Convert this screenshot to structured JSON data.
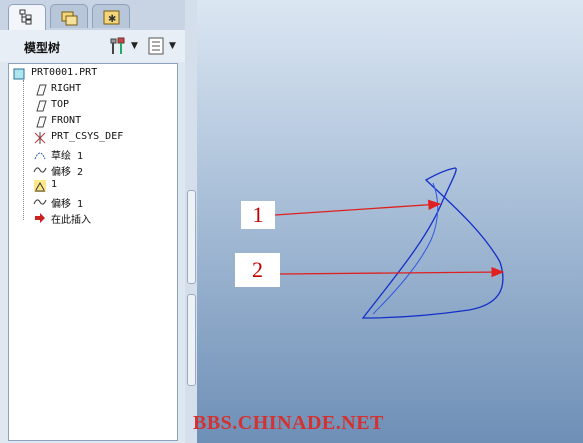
{
  "tabs": [
    {
      "name": "model-tree-tab",
      "icon": "tree-icon",
      "active": true
    },
    {
      "name": "folder-tab",
      "icon": "folder-icon",
      "active": false
    },
    {
      "name": "favorites-tab",
      "icon": "star-icon",
      "active": false
    }
  ],
  "panel": {
    "title": "模型树",
    "settings_icon": "settings-tool-icon",
    "show_icon": "show-list-icon"
  },
  "tree": {
    "root": {
      "label": "PRT0001.PRT",
      "icon": "part-icon"
    },
    "items": [
      {
        "label": "RIGHT",
        "icon": "datum-plane-icon"
      },
      {
        "label": "TOP",
        "icon": "datum-plane-icon"
      },
      {
        "label": "FRONT",
        "icon": "datum-plane-icon"
      },
      {
        "label": "PRT_CSYS_DEF",
        "icon": "csys-icon"
      },
      {
        "label": "草绘 1",
        "icon": "sketch-icon"
      },
      {
        "label": "偏移 2",
        "icon": "curve-icon"
      },
      {
        "label": "1",
        "icon": "feature-icon"
      },
      {
        "label": "偏移 1",
        "icon": "curve-icon"
      },
      {
        "label": "在此插入",
        "icon": "insert-here-arrow-icon"
      }
    ]
  },
  "callouts": [
    "1",
    "2"
  ],
  "watermark": "BBS.CHINADE.NET",
  "colors": {
    "curve": "#1430c8",
    "callout_arrow": "#e02020",
    "watermark": "#d43232"
  }
}
